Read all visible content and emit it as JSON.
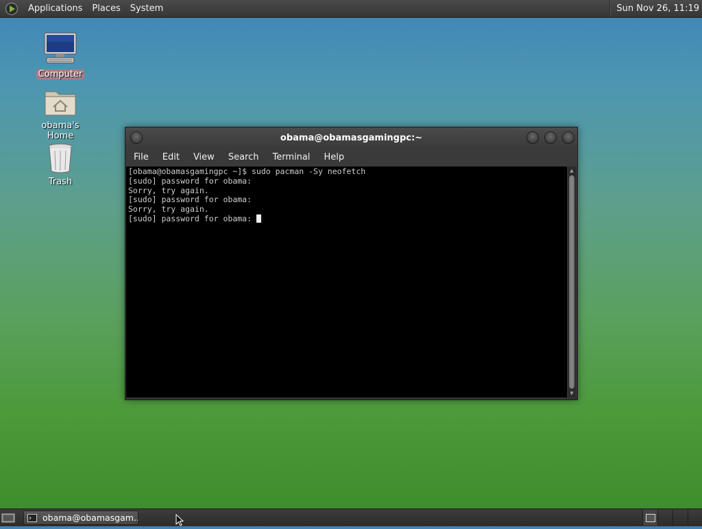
{
  "top_panel": {
    "menus": [
      "Applications",
      "Places",
      "System"
    ],
    "clock": "Sun Nov 26, 11:19"
  },
  "desktop": {
    "icons": [
      {
        "label": "Computer",
        "icon": "computer-icon",
        "selected": true
      },
      {
        "label": "obama's Home",
        "icon": "home-folder-icon",
        "selected": false
      },
      {
        "label": "Trash",
        "icon": "trash-icon",
        "selected": false
      }
    ]
  },
  "terminal": {
    "title": "obama@obamasgamingpc:~",
    "menu": [
      "File",
      "Edit",
      "View",
      "Search",
      "Terminal",
      "Help"
    ],
    "lines": [
      "[obama@obamasgamingpc ~]$ sudo pacman -Sy neofetch",
      "[sudo] password for obama:",
      "Sorry, try again.",
      "[sudo] password for obama:",
      "Sorry, try again.",
      "[sudo] password for obama: "
    ]
  },
  "taskbar": {
    "task_label": "obama@obamasgam..."
  },
  "colors": {
    "panel": "#3a3a3a",
    "terminal_bg": "#000000",
    "terminal_fg": "#cfcfcf",
    "selection": "#d66e6e"
  }
}
